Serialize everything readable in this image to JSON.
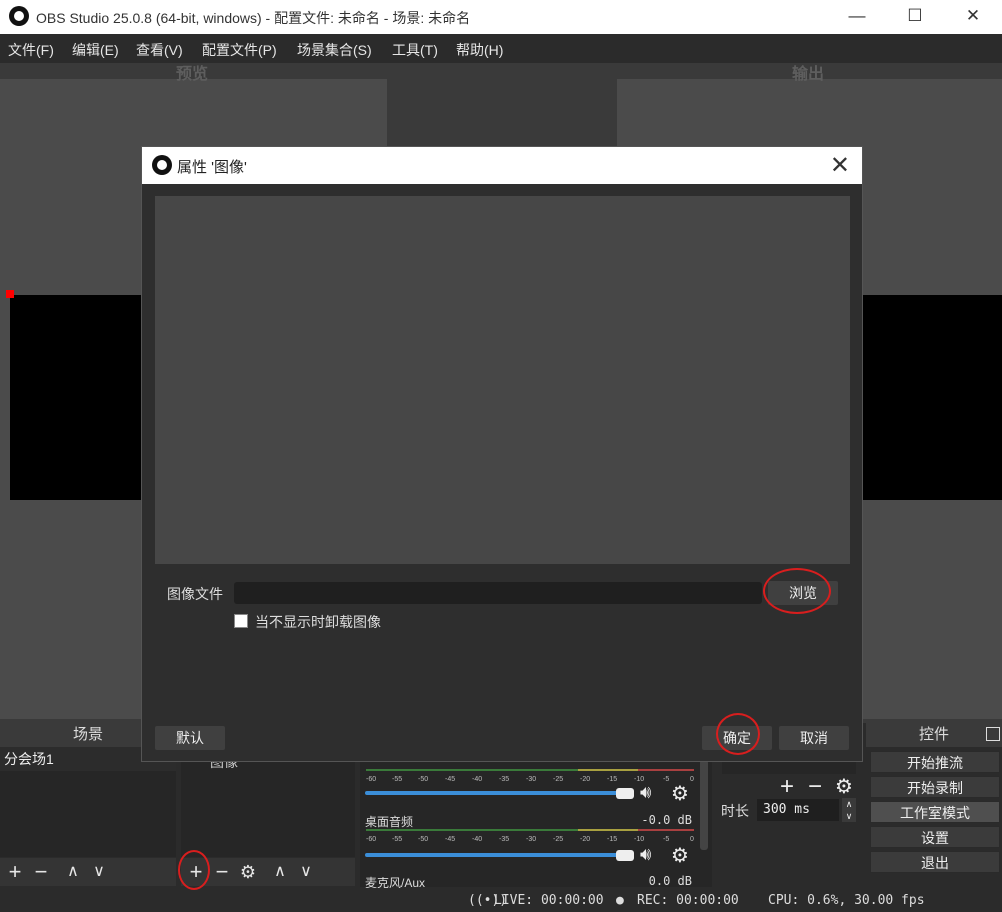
{
  "window": {
    "title": "OBS Studio 25.0.8 (64-bit, windows) - 配置文件: 未命名 - 场景: 未命名",
    "minimize": "—",
    "maximize": "☐",
    "close": "✕"
  },
  "menu": [
    "文件(F)",
    "编辑(E)",
    "查看(V)",
    "配置文件(P)",
    "场景集合(S)",
    "工具(T)",
    "帮助(H)"
  ],
  "preview": {
    "left_label": "预览",
    "right_label": "输出"
  },
  "docks": {
    "scenes": {
      "title": "场景",
      "items": [
        "分会场1"
      ]
    },
    "sources": {
      "items": [
        "图像"
      ]
    },
    "mixer": {
      "channels": [
        {
          "name": "桌面音频",
          "db": "-0.0 dB"
        },
        {
          "name": "麦克风/Aux",
          "db": "0.0 dB"
        }
      ],
      "scale": [
        "-60",
        "-55",
        "-50",
        "-45",
        "-40",
        "-35",
        "-30",
        "-25",
        "-20",
        "-15",
        "-10",
        "-5",
        "0"
      ]
    },
    "transitions": {
      "duration_label": "时长",
      "duration_value": "300 ms"
    },
    "controls": {
      "title": "控件",
      "buttons": [
        "开始推流",
        "开始录制",
        "工作室模式",
        "设置",
        "退出"
      ]
    }
  },
  "status": {
    "live": "LIVE: 00:00:00",
    "rec": "REC: 00:00:00",
    "cpu": "CPU: 0.6%, 30.00 fps"
  },
  "dialog": {
    "title": "属性 '图像'",
    "image_file_label": "图像文件",
    "image_file_value": "",
    "browse": "浏览",
    "unload_label": "当不显示时卸载图像",
    "defaults": "默认",
    "ok": "确定",
    "cancel": "取消"
  },
  "colors": {
    "highlight_circle": "#d81e1e",
    "slider": "#3b8ed8"
  }
}
